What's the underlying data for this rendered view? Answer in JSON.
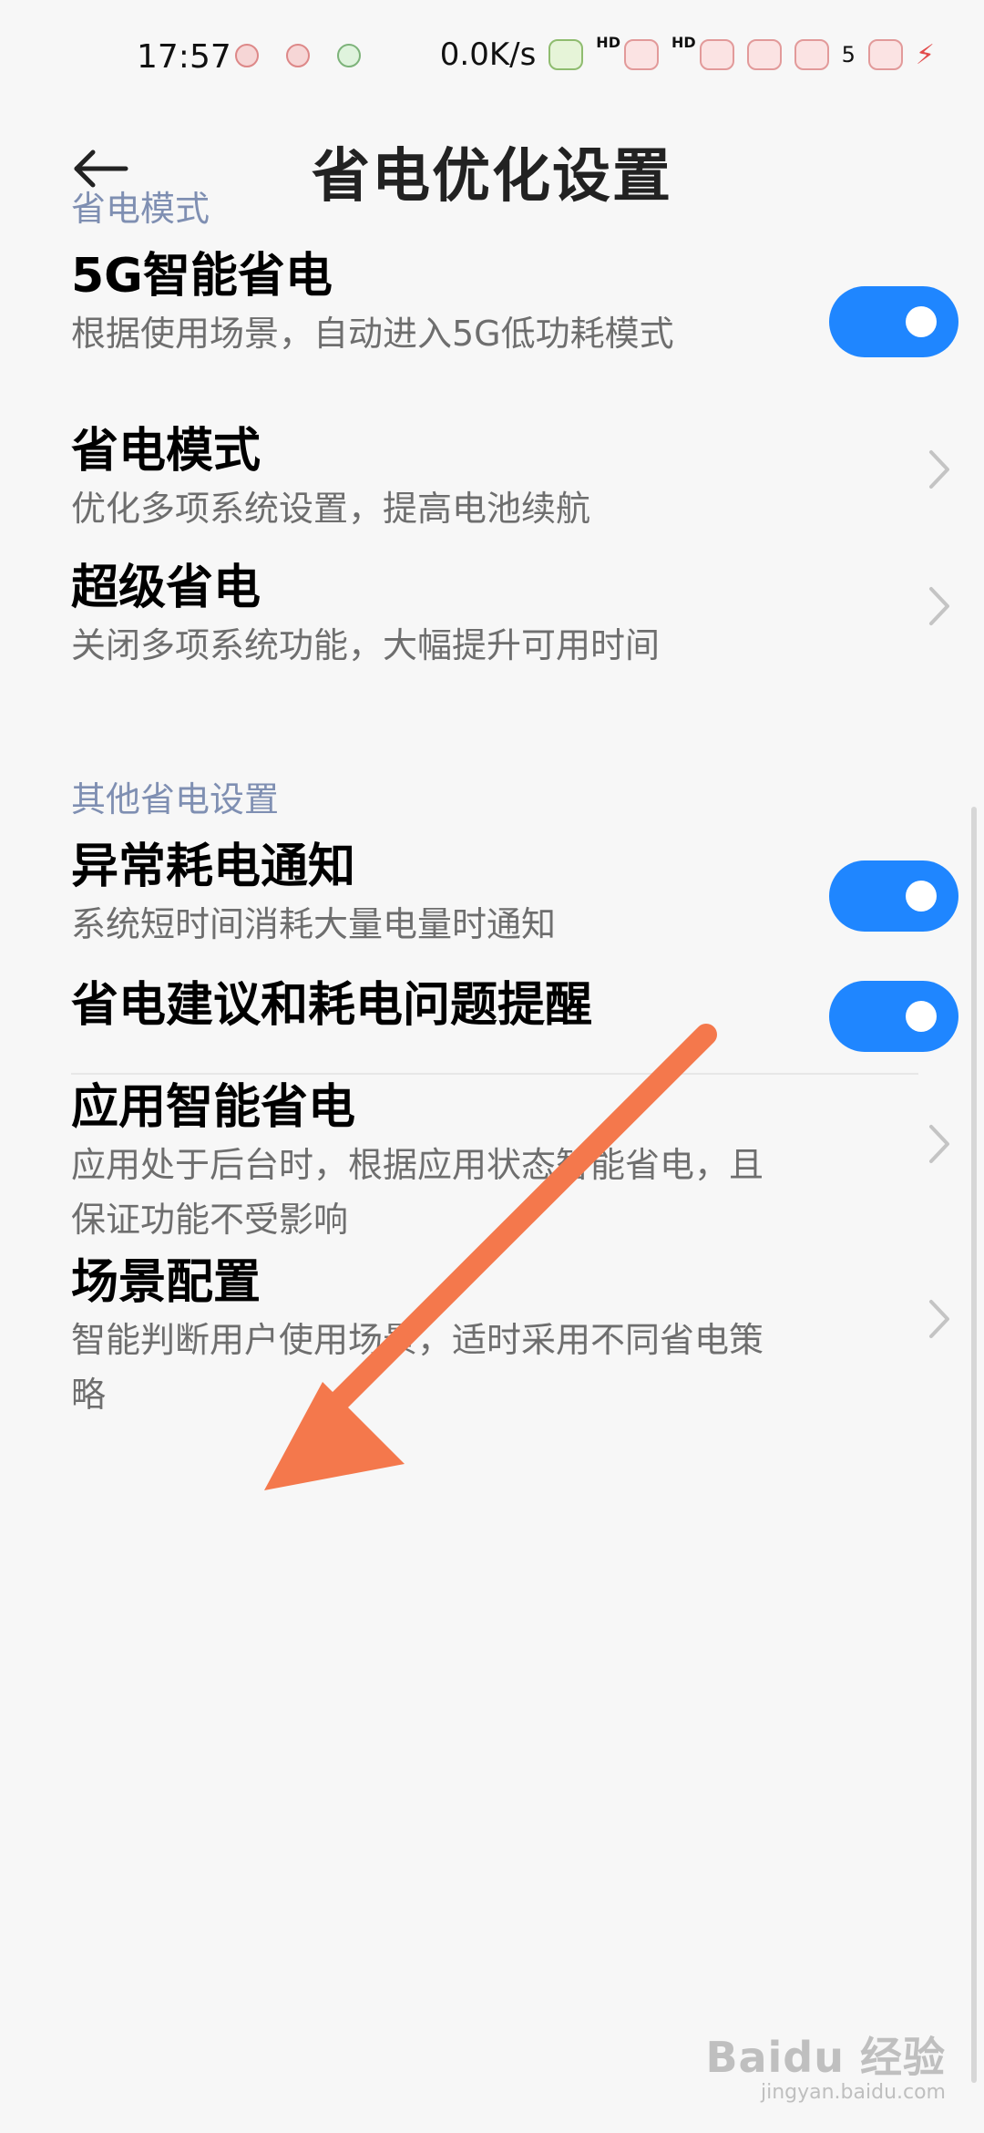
{
  "status": {
    "time": "17:57",
    "speed": "0.0K/s",
    "hd_left": "HD",
    "hd_right": "HD",
    "badge_count": "5",
    "icons": [
      "sticker-icon",
      "sticker-icon",
      "sticker-icon",
      "sticker-icon",
      "sticker-icon",
      "sticker-icon",
      "sticker-icon",
      "sticker-icon",
      "bolt-icon"
    ]
  },
  "header": {
    "title": "省电优化设置"
  },
  "sections": [
    {
      "label": "省电模式",
      "items": [
        {
          "title": "5G智能省电",
          "desc": "根据使用场景，自动进入5G低功耗模式",
          "control": "toggle",
          "state": true
        },
        {
          "title": "省电模式",
          "desc": "优化多项系统设置，提高电池续航",
          "control": "chevron"
        },
        {
          "title": "超级省电",
          "desc": "关闭多项系统功能，大幅提升可用时间",
          "control": "chevron"
        }
      ]
    },
    {
      "label": "其他省电设置",
      "items": [
        {
          "title": "异常耗电通知",
          "desc": "系统短时间消耗大量电量时通知",
          "control": "toggle",
          "state": true
        },
        {
          "title": "省电建议和耗电问题提醒",
          "desc": "",
          "control": "toggle",
          "state": true
        },
        {
          "title": "应用智能省电",
          "desc": "应用处于后台时，根据应用状态智能省电，且保证功能不受影响",
          "control": "chevron"
        },
        {
          "title": "场景配置",
          "desc": "智能判断用户使用场景，适时采用不同省电策略",
          "control": "chevron"
        }
      ]
    }
  ],
  "watermark": {
    "main": "Baidu 经验",
    "sub": "jingyan.baidu.com"
  },
  "colors": {
    "accent": "#1f86ff",
    "section_label": "#7f8fb2",
    "arrow": "#f4784c"
  }
}
